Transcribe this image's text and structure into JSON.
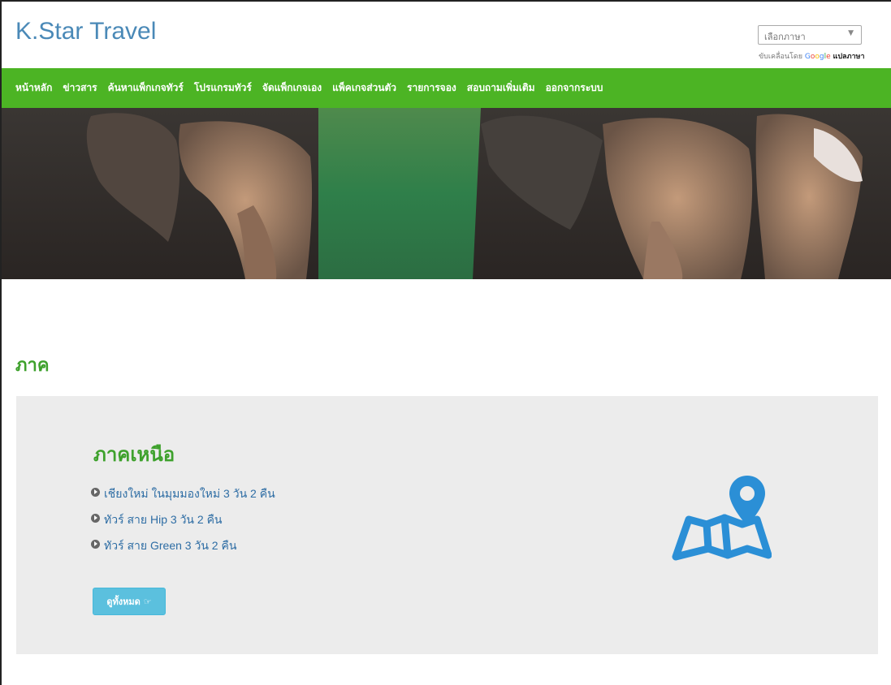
{
  "header": {
    "brand": "K.Star Travel",
    "language_select": "เลือกภาษา",
    "powered_by": "ขับเคลื่อนโดย",
    "google": "Google",
    "translate": "แปลภาษา"
  },
  "nav": {
    "items": [
      {
        "label": "หน้าหลัก"
      },
      {
        "label": "ข่าวสาร"
      },
      {
        "label": "ค้นหาแพ็กเกจทัวร์"
      },
      {
        "label": "โปรแกรมทัวร์"
      },
      {
        "label": "จัดแพ็กเกจเอง"
      },
      {
        "label": "แพ็คเกจส่วนตัว"
      },
      {
        "label": "รายการจอง"
      },
      {
        "label": "สอบถามเพิ่มเติม"
      },
      {
        "label": "ออกจากระบบ"
      }
    ]
  },
  "hero": {
    "image": "elephants-in-river-banner"
  },
  "section": {
    "title": "ภาค"
  },
  "region": {
    "title": "ภาคเหนือ",
    "tours": [
      "เชียงใหม่ ในมุมมองใหม่ 3 วัน 2 คืน",
      "ทัวร์ สาย Hip 3 วัน 2 คืน",
      "ทัวร์ สาย Green 3 วัน 2 คืน"
    ],
    "view_all": "ดูทั้งหมด",
    "icon": "map-pin-icon"
  },
  "colors": {
    "nav_green": "#4cb424",
    "title_green": "#3ea12c",
    "brand_blue": "#4a89b7",
    "button_blue": "#5bc0de",
    "icon_blue": "#2b8fd6"
  }
}
